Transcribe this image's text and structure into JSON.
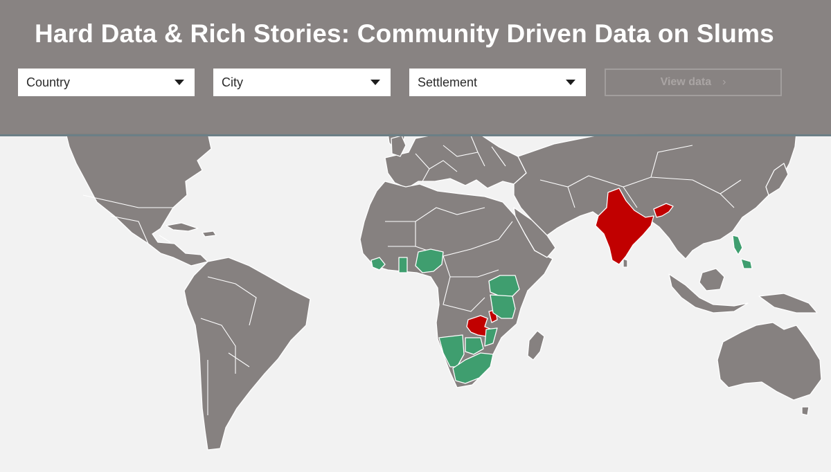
{
  "header": {
    "title": "Hard Data & Rich Stories: Community Driven Data on Slums"
  },
  "filters": {
    "country": {
      "selected": "Country"
    },
    "city": {
      "selected": "City"
    },
    "settlement": {
      "selected": "Settlement"
    },
    "view_button": {
      "label": "View data",
      "arrow": "›",
      "enabled": false
    }
  },
  "map": {
    "colors": {
      "ocean": "#f2f2f2",
      "land": "#868180",
      "highlight_green": "#3f9e6f",
      "highlight_red": "#c10000",
      "header": "#847f7e"
    }
  }
}
